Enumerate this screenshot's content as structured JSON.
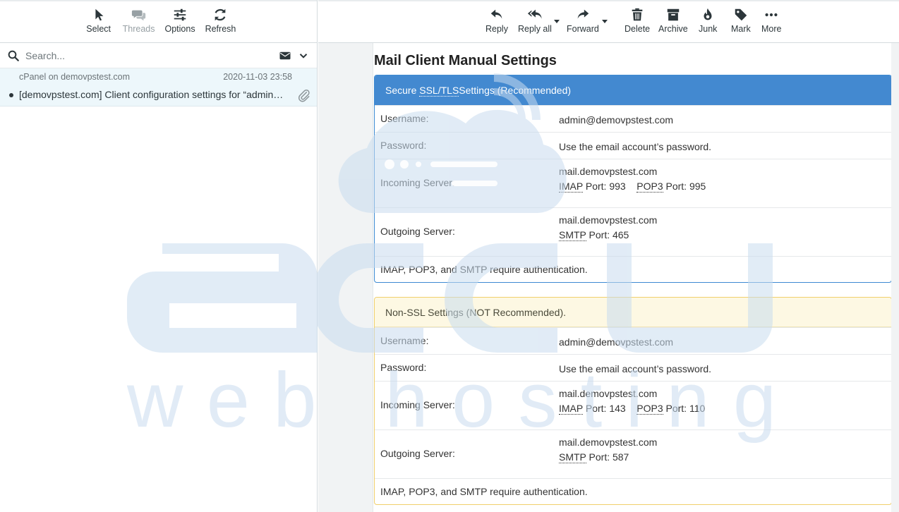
{
  "left_toolbar": [
    {
      "label": "Select",
      "icon": "pointer-icon",
      "disabled": false
    },
    {
      "label": "Threads",
      "icon": "comments-icon",
      "disabled": true
    },
    {
      "label": "Options",
      "icon": "sliders-icon",
      "disabled": false
    },
    {
      "label": "Refresh",
      "icon": "refresh-icon",
      "disabled": false
    }
  ],
  "search": {
    "placeholder": "Search..."
  },
  "message": {
    "from": "cPanel on demovpstest.com",
    "date": "2020-11-03 23:58",
    "subject": "[demovpstest.com] Client configuration settings for “admin@demovpstest.com”",
    "unread": true,
    "has_attachment": true
  },
  "right_toolbar": [
    {
      "label": "Reply",
      "icon": "reply-icon"
    },
    {
      "label": "Reply all",
      "icon": "reply-all-icon"
    },
    {
      "label": "Forward",
      "icon": "forward-icon"
    },
    {
      "label": "Delete",
      "icon": "trash-icon"
    },
    {
      "label": "Archive",
      "icon": "archive-icon"
    },
    {
      "label": "Junk",
      "icon": "fire-icon"
    },
    {
      "label": "Mark",
      "icon": "tag-icon"
    },
    {
      "label": "More",
      "icon": "ellipsis-icon"
    }
  ],
  "content": {
    "title": "Mail Client Manual Settings",
    "ssl": {
      "heading_prefix": "Secure ",
      "heading_abbr": "SSL/TLS",
      "heading_suffix": " Settings (Recommended)",
      "username_label": "Username:",
      "username": "admin@demovpstest.com",
      "password_label": "Password:",
      "password": "Use the email account’s password.",
      "incoming_label": "Incoming Server:",
      "incoming_host": "mail.demovpstest.com",
      "imap_abbr": "IMAP",
      "imap_port": " Port: 993",
      "pop3_abbr": "POP3",
      "pop3_port": " Port: 995",
      "outgoing_label": "Outgoing Server:",
      "outgoing_host": "mail.demovpstest.com",
      "smtp_abbr": "SMTP",
      "smtp_port": " Port: 465",
      "auth_note": "IMAP, POP3, and SMTP require authentication."
    },
    "nonssl": {
      "heading": "Non-SSL Settings (NOT Recommended).",
      "username_label": "Username:",
      "username": "admin@demovpstest.com",
      "password_label": "Password:",
      "password": "Use the email account’s password.",
      "incoming_label": "Incoming Server:",
      "incoming_host": "mail.demovpstest.com",
      "imap_abbr": "IMAP",
      "imap_port": " Port: 143",
      "pop3_abbr": "POP3",
      "pop3_port": " Port: 110",
      "outgoing_label": "Outgoing Server:",
      "outgoing_host": "mail.demovpstest.com",
      "smtp_abbr": "SMTP",
      "smtp_port": " Port: 587",
      "auth_note": "IMAP, POP3, and SMTP require authentication."
    }
  },
  "watermark": {
    "brand": "accu",
    "tagline": "web hosting",
    "color": "#c9dcef"
  },
  "colors": {
    "ssl_header": "#4389d0",
    "nonssl_header": "#fdf8e3",
    "selected_message": "#edf7fb"
  }
}
